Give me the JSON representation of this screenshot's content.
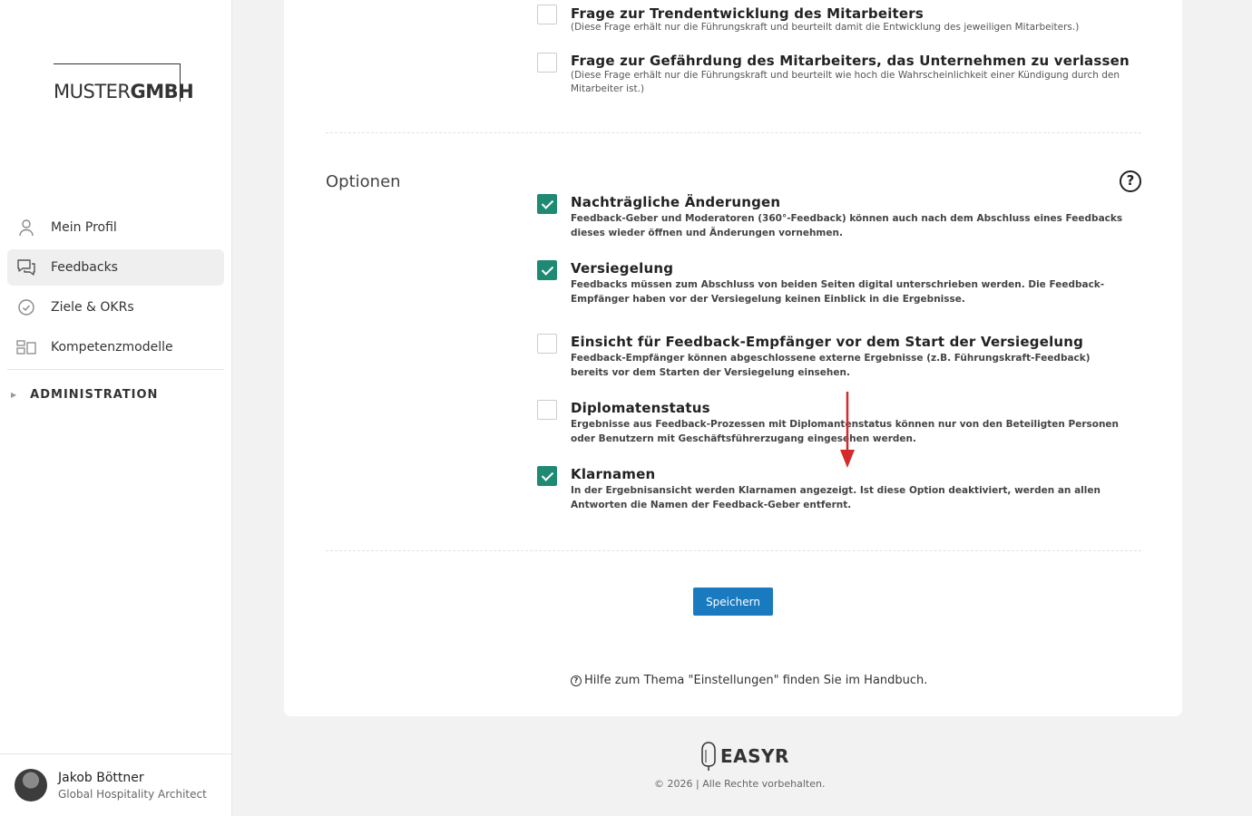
{
  "logo": {
    "part1": "MUSTER",
    "part2": "GMBH"
  },
  "nav": {
    "items": [
      {
        "label": "Mein Profil",
        "icon": "person-icon"
      },
      {
        "label": "Feedbacks",
        "icon": "chat-icon",
        "active": true
      },
      {
        "label": "Ziele & OKRs",
        "icon": "check-circle-icon"
      },
      {
        "label": "Kompetenzmodelle",
        "icon": "grid-icon"
      }
    ],
    "admin_label": "ADMINISTRATION"
  },
  "user": {
    "name": "Jakob Böttner",
    "role": "Global Hospitality Architect"
  },
  "questions": [
    {
      "title": "Frage zur Trendentwicklung des Mitarbeiters",
      "desc": "(Diese Frage erhält nur die Führungskraft und beurteilt damit die Entwicklung des jeweiligen Mitarbeiters.)",
      "checked": false
    },
    {
      "title": "Frage zur Gefährdung des Mitarbeiters, das Unternehmen zu verlassen",
      "desc": "(Diese Frage erhält nur die Führungskraft und beurteilt wie hoch die Wahrscheinlichkeit einer Kündigung durch den Mitarbeiter ist.)",
      "checked": false
    }
  ],
  "options_section": {
    "label": "Optionen",
    "help_glyph": "?",
    "items": [
      {
        "title": "Nachträgliche Änderungen",
        "desc": "Feedback-Geber und Moderatoren (360°-Feedback) können auch nach dem Abschluss eines Feedbacks dieses wieder öffnen und Änderungen vornehmen.",
        "checked": true
      },
      {
        "title": "Versiegelung",
        "desc": "Feedbacks müssen zum Abschluss von beiden Seiten digital unterschrieben werden. Die Feedback-Empfänger haben vor der Versiegelung keinen Einblick in die Ergebnisse.",
        "checked": true
      },
      {
        "title": "Einsicht für Feedback-Empfänger vor dem Start der Versiegelung",
        "desc": "Feedback-Empfänger können abgeschlossene externe Ergebnisse (z.B. Führungskraft-Feedback) bereits vor dem Starten der Versiegelung einsehen.",
        "checked": false
      },
      {
        "title": "Diplomatenstatus",
        "desc": "Ergebnisse aus Feedback-Prozessen mit Diplomantenstatus können nur von den Beteiligten Personen oder Benutzern mit Geschäftsführerzugang eingesehen werden.",
        "checked": false
      },
      {
        "title": "Klarnamen",
        "desc": "In der Ergebnisansicht werden Klarnamen angezeigt. Ist diese Option deaktiviert, werden an allen Antworten die Namen der Feedback-Geber entfernt.",
        "checked": true
      }
    ]
  },
  "save_label": "Speichern",
  "help_text": "Hilfe zum Thema \"Einstellungen\" finden Sie im Handbuch.",
  "footer": {
    "brand": "EASYR",
    "copyright": "© 2026 | Alle Rechte vorbehalten."
  },
  "colors": {
    "accent": "#1f8a73",
    "button": "#1a7ac0",
    "arrow": "#d32a2a"
  }
}
